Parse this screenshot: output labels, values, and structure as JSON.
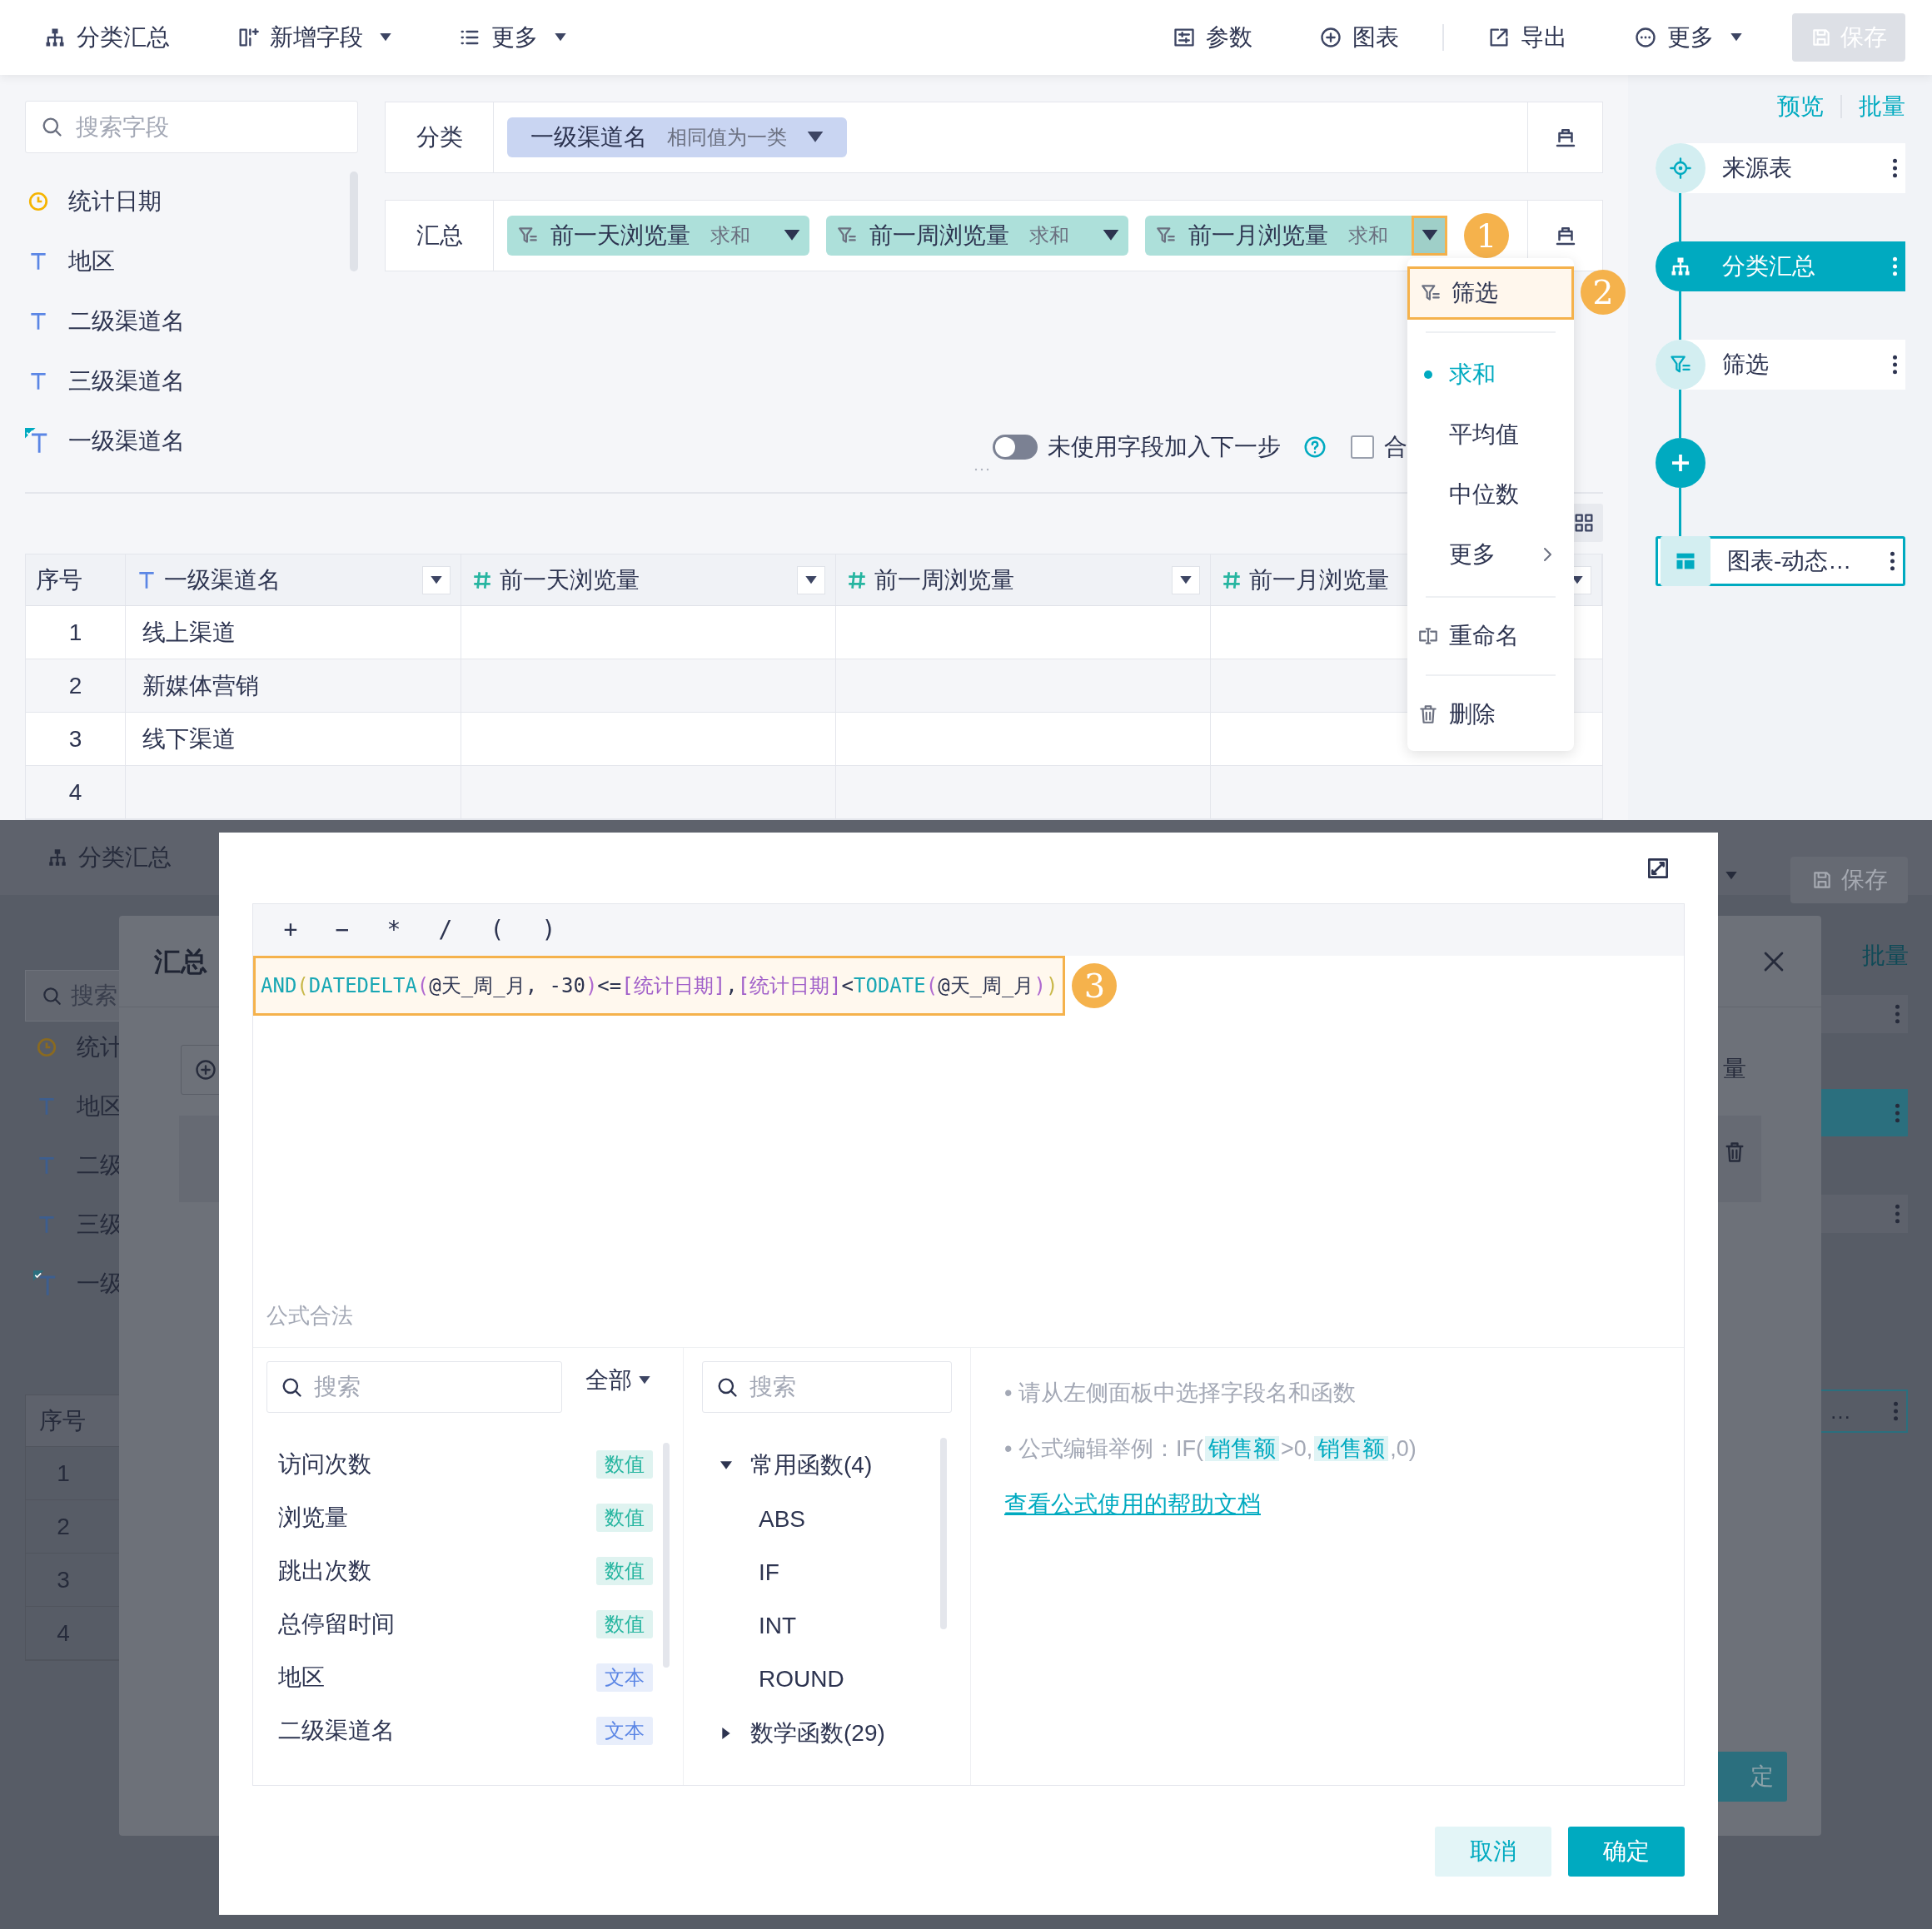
{
  "toolbar": {
    "left": [
      {
        "label": "分类汇总",
        "caret": false
      },
      {
        "label": "新增字段",
        "caret": true
      },
      {
        "label": "更多",
        "caret": true
      }
    ],
    "right": [
      {
        "label": "参数",
        "caret": false
      },
      {
        "label": "图表",
        "caret": false
      },
      {
        "label": "导出",
        "caret": false
      },
      {
        "label": "更多",
        "caret": true
      }
    ],
    "save": {
      "label": "保存",
      "disabled": true
    }
  },
  "field_panel": {
    "search": {
      "placeholder": "搜索字段"
    },
    "fields": [
      {
        "name": "统计日期",
        "kind": "date"
      },
      {
        "name": "地区",
        "kind": "text"
      },
      {
        "name": "二级渠道名",
        "kind": "text"
      },
      {
        "name": "三级渠道名",
        "kind": "text"
      },
      {
        "name": "一级渠道名",
        "kind": "text-new"
      }
    ]
  },
  "category_row": {
    "label": "分类",
    "chips": [
      {
        "name": "一级渠道名",
        "mode": "相同值为一类"
      }
    ]
  },
  "summary_row": {
    "label": "汇总",
    "callout": "1",
    "chips": [
      {
        "name": "前一天浏览量",
        "agg": "求和",
        "selected": false
      },
      {
        "name": "前一周浏览量",
        "agg": "求和",
        "selected": false
      },
      {
        "name": "前一月浏览量",
        "agg": "求和",
        "selected": true
      }
    ]
  },
  "options": {
    "unused_toggle": {
      "label": "未使用字段加入下一步",
      "on": false
    },
    "merge_checkbox": {
      "label": "合",
      "checked": false
    }
  },
  "table": {
    "columns": [
      {
        "label": "序号",
        "kind": "index"
      },
      {
        "label": "一级渠道名",
        "kind": "text"
      },
      {
        "label": "前一天浏览量",
        "kind": "number"
      },
      {
        "label": "前一周浏览量",
        "kind": "number"
      },
      {
        "label": "前一月浏览量",
        "kind": "number"
      }
    ],
    "rows": [
      {
        "index": "1",
        "channel": "线上渠道"
      },
      {
        "index": "2",
        "channel": "新媒体营销"
      },
      {
        "index": "3",
        "channel": "线下渠道"
      },
      {
        "index": "4"
      }
    ]
  },
  "menu": {
    "callout": "2",
    "groups": [
      [
        {
          "label": "筛选",
          "kind": "filter",
          "highlighted": true
        }
      ],
      [
        {
          "label": "求和",
          "kind": "option",
          "selected": true
        },
        {
          "label": "平均值",
          "kind": "option",
          "selected": false
        },
        {
          "label": "中位数",
          "kind": "option",
          "selected": false
        },
        {
          "label": "更多",
          "kind": "submenu"
        }
      ],
      [
        {
          "label": "重命名",
          "kind": "rename"
        }
      ],
      [
        {
          "label": "删除",
          "kind": "delete"
        }
      ]
    ]
  },
  "flow_panel": {
    "links": [
      "预览",
      "批量"
    ],
    "steps": [
      {
        "label": "来源表",
        "kind": "source",
        "selected": false
      },
      {
        "label": "分类汇总",
        "kind": "group",
        "selected": true
      },
      {
        "label": "筛选",
        "kind": "filter",
        "selected": false
      },
      {
        "kind": "add"
      },
      {
        "label": "图表-动态…",
        "kind": "chart",
        "selected": false
      }
    ]
  },
  "background_app": {
    "title": "分类汇总",
    "save": "保存",
    "link": "批量",
    "search": "搜索",
    "fields": [
      {
        "name": "统计",
        "kind": "date"
      },
      {
        "name": "地区",
        "kind": "text"
      },
      {
        "name": "二级",
        "kind": "text"
      },
      {
        "name": "三级",
        "kind": "text"
      },
      {
        "name": "一级",
        "kind": "text-new"
      }
    ],
    "table_header": "序号",
    "row_numbers": [
      "1",
      "2",
      "3",
      "4"
    ],
    "step_fragment": "…"
  },
  "background_dialog": {
    "title": "汇总",
    "column_fragment": "量",
    "confirm_fragment": "定"
  },
  "formula_dialog": {
    "operators": [
      "+",
      "−",
      "*",
      "/",
      "(",
      ")"
    ],
    "formula": [
      {
        "kind": "func",
        "text": "AND"
      },
      {
        "kind": "paren",
        "text": "("
      },
      {
        "kind": "func",
        "text": "DATEDELTA"
      },
      {
        "kind": "paren2",
        "text": "("
      },
      {
        "kind": "plain",
        "text": "@天_周_月, -30"
      },
      {
        "kind": "paren2",
        "text": ")"
      },
      {
        "kind": "plain",
        "text": "<="
      },
      {
        "kind": "field",
        "text": "[统计日期]"
      },
      {
        "kind": "plain",
        "text": ","
      },
      {
        "kind": "field",
        "text": "[统计日期]"
      },
      {
        "kind": "plain",
        "text": "<"
      },
      {
        "kind": "func",
        "text": "TODATE"
      },
      {
        "kind": "paren2",
        "text": "("
      },
      {
        "kind": "plain",
        "text": "@天_周_月"
      },
      {
        "kind": "paren2",
        "text": ")"
      },
      {
        "kind": "paren",
        "text": ")"
      }
    ],
    "callout": "3",
    "status": "公式合法",
    "field_search": {
      "placeholder": "搜索"
    },
    "field_filter": "全部",
    "fields": [
      {
        "name": "访问次数",
        "type": "数值",
        "kind": "number"
      },
      {
        "name": "浏览量",
        "type": "数值",
        "kind": "number"
      },
      {
        "name": "跳出次数",
        "type": "数值",
        "kind": "number"
      },
      {
        "name": "总停留时间",
        "type": "数值",
        "kind": "number"
      },
      {
        "name": "地区",
        "type": "文本",
        "kind": "text"
      },
      {
        "name": "二级渠道名",
        "type": "文本",
        "kind": "text"
      }
    ],
    "function_search": {
      "placeholder": "搜索"
    },
    "function_groups": [
      {
        "name": "常用函数(4)",
        "expanded": true,
        "children": [
          {
            "name": "ABS"
          },
          {
            "name": "IF"
          },
          {
            "name": "INT"
          },
          {
            "name": "ROUND"
          }
        ]
      },
      {
        "name": "数学函数(29)",
        "expanded": false
      }
    ],
    "hints": [
      [
        {
          "kind": "plain",
          "text": "• 请从左侧面板中选择字段名和函数"
        }
      ],
      [
        {
          "kind": "plain",
          "text": "• 公式编辑举例：IF("
        },
        {
          "kind": "field",
          "text": "销售额"
        },
        {
          "kind": "plain",
          "text": ">0,"
        },
        {
          "kind": "field",
          "text": "销售额"
        },
        {
          "kind": "plain",
          "text": ",0)"
        }
      ]
    ],
    "help_link": "查看公式使用的帮助文档",
    "buttons": [
      {
        "label": "取消",
        "kind": "secondary"
      },
      {
        "label": "确定",
        "kind": "primary"
      }
    ]
  }
}
